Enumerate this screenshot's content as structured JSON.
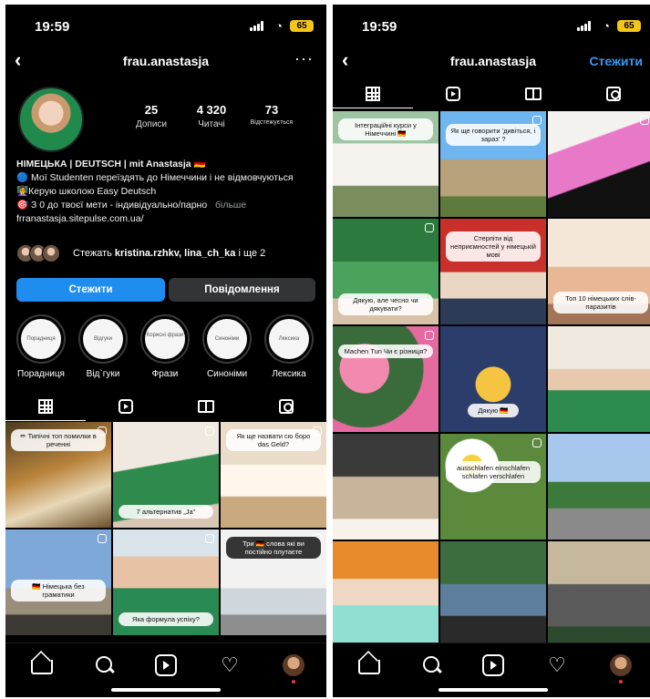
{
  "status": {
    "time": "19:59",
    "battery": "65"
  },
  "profile": {
    "username": "frau.anastasja",
    "stats": [
      {
        "num": "25",
        "label": "Дописи"
      },
      {
        "num": "4 320",
        "label": "Читачі"
      },
      {
        "num": "73",
        "label": "Відстежується"
      }
    ],
    "bio": {
      "name": "НІМЕЦЬКА | DEUTSCH | mit Anastasja 🇩🇪",
      "line1": "🔵 Мої Studenten переїздять до Німеччини і не відмовчуються",
      "line2": "👩‍🏫Керую школою Easy Deutsch",
      "line3": "🎯 З 0 до твоєї мети - індивідуально/парно",
      "more": "більше",
      "link": "frranastasja.sitepulse.com.ua/"
    },
    "followed_by": {
      "prefix": "Стежать ",
      "names": "kristina.rzhkv, lina_ch_ka",
      "suffix": " і ще 2"
    },
    "buttons": {
      "follow": "Стежити",
      "message": "Повідомлення"
    },
    "highlights": [
      {
        "cover": "Порадниця",
        "label": "Порадниця"
      },
      {
        "cover": "Відгуки",
        "label": "Від`гуки"
      },
      {
        "cover": "Корисні фрази",
        "label": "Фрази"
      },
      {
        "cover": "Синоніми",
        "label": "Синоніми"
      },
      {
        "cover": "Лексика",
        "label": "Лексика"
      }
    ],
    "posts": [
      "✏ Типічні топ помилки в реченні",
      "7 альтернатив „Ja\"",
      "Як ще назвати сю боро das Geld?",
      "🇩🇪 Німецька без граматики",
      "Яка формула успіху?",
      "Три 🇩🇪 слова які ви постійно плутаєте"
    ]
  },
  "right": {
    "username": "frau.anastasja",
    "follow_link": "Стежити",
    "posts": [
      "Інтеграційні курси у Німеччині 🇩🇪",
      "Як ще говорити 'дивіться, і зараз' ?",
      "",
      "Дякую, але чесно чи дякувати?",
      "Стерпіти від неприємностей у німецькій мові",
      "Топ 10 німецьких слів-паразитів",
      "Machen Tun Чи є різниця?",
      "Дякую 🇩🇪",
      "",
      "",
      "ausschlafen einschlafen schlafen verschlafen",
      "",
      "",
      "",
      ""
    ]
  }
}
